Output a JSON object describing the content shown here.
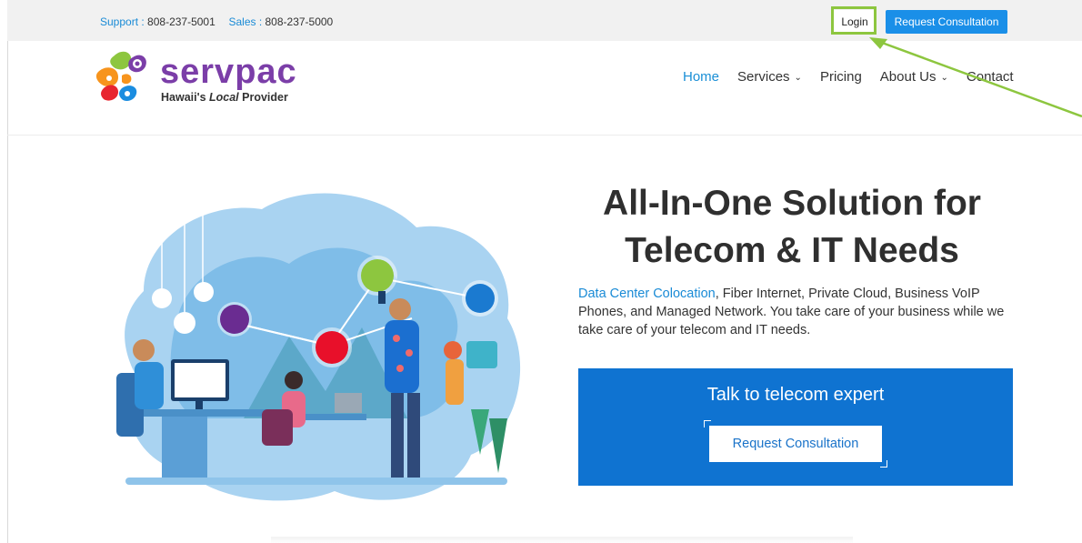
{
  "topbar": {
    "support_label": "Support :",
    "support_phone": "808-237-5001",
    "sales_label": "Sales :",
    "sales_phone": "808-237-5000",
    "login_label": "Login",
    "request_label": "Request Consultation"
  },
  "header": {
    "logo_name": "servpac",
    "logo_tagline_prefix": "Hawaii's ",
    "logo_tagline_local": "Local",
    "logo_tagline_suffix": " Provider",
    "nav": [
      {
        "label": "Home",
        "dropdown": false
      },
      {
        "label": "Services",
        "dropdown": true
      },
      {
        "label": "Pricing",
        "dropdown": false
      },
      {
        "label": "About Us",
        "dropdown": true
      },
      {
        "label": "Contact",
        "dropdown": false
      }
    ]
  },
  "hero": {
    "title_line1": "All-In-One Solution for",
    "title_line2": "Telecom & IT Needs",
    "desc_link": "Data Center Colocation",
    "desc_rest": ", Fiber Internet, Private Cloud, Business VoIP Phones, and Managed Network. You take care of your business while we take care of your telecom and IT needs.",
    "cta_title": "Talk to telecom expert",
    "cta_button": "Request Consultation"
  },
  "colors": {
    "accent": "#1a8fe8",
    "cta_bg": "#0f73d1",
    "highlight": "#8dc63f",
    "brand_purple": "#7b3ea8"
  },
  "icons": {
    "chevron": "chevron-down-icon",
    "annotation": "annotation-arrow-icon"
  }
}
